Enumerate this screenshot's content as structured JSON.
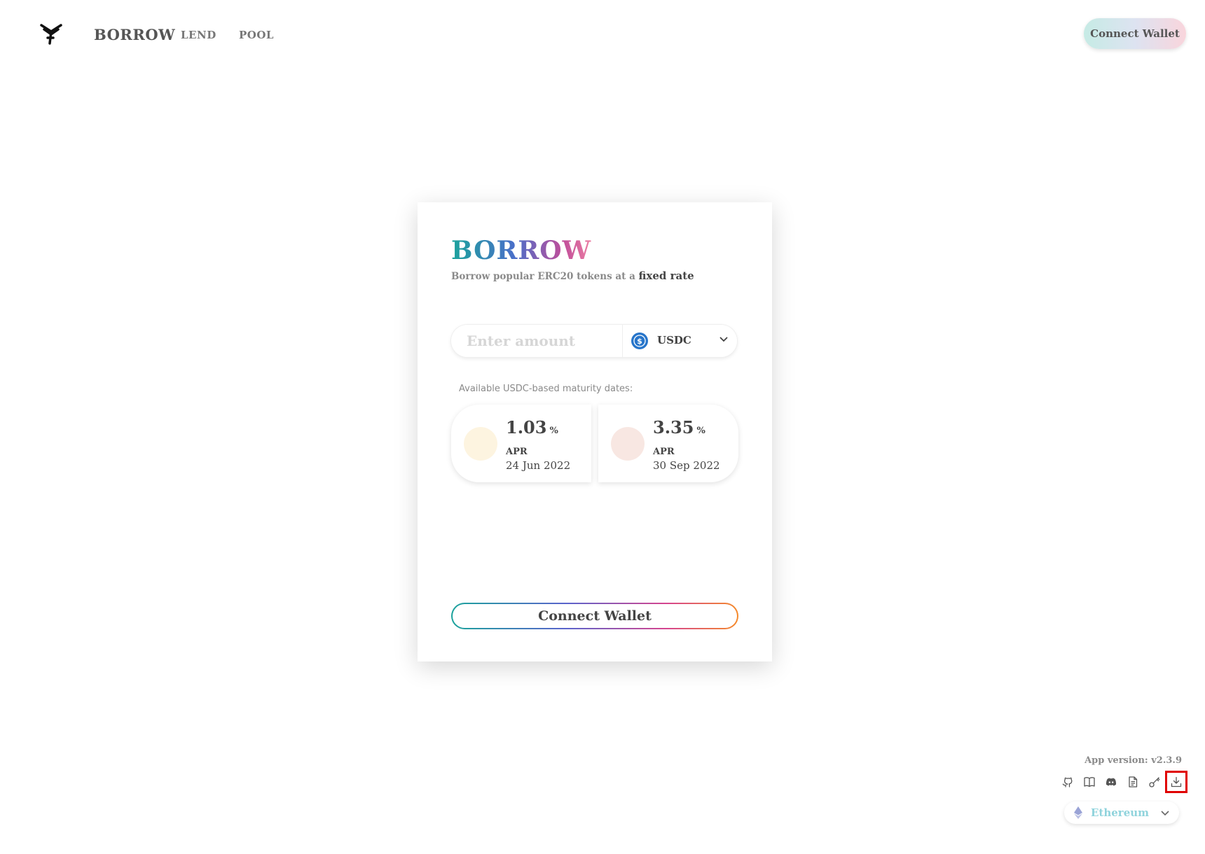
{
  "header": {
    "nav": {
      "borrow": "BORROW",
      "lend": "LEND",
      "pool": "POOL"
    },
    "connect_label": "Connect Wallet"
  },
  "card": {
    "title": "BORROW",
    "subtitle_prefix": "Borrow popular ERC20 tokens at a ",
    "subtitle_emphasis": "fixed rate",
    "amount": {
      "value": "",
      "placeholder": "Enter amount"
    },
    "token": {
      "selected": "USDC",
      "icon": "usdc-icon"
    },
    "maturities_label": "Available USDC-based maturity dates:",
    "pools": [
      {
        "rate": "1.03",
        "unit": "%",
        "label": "APR",
        "date": "24 Jun 2022",
        "color": "#fdf4e0"
      },
      {
        "rate": "3.35",
        "unit": "%",
        "label": "APR",
        "date": "30 Sep 2022",
        "color": "#f8e7e2"
      }
    ],
    "connect_label": "Connect Wallet"
  },
  "footer": {
    "app_version": "App version: v2.3.9",
    "icons": [
      "github-icon",
      "docs-book-icon",
      "discord-icon",
      "document-icon",
      "key-icon",
      "download-icon"
    ],
    "selected_icon": "download-icon",
    "network": {
      "label": "Ethereum",
      "icon": "ethereum-icon"
    }
  },
  "colors": {
    "accent_gradient": [
      "#1ba39c",
      "#5a64cc",
      "#d6458f",
      "#f58a2a"
    ],
    "header_button_gradient": [
      "#c6ebe5",
      "#dde3f1",
      "#f9d5dc"
    ],
    "selection_outline": "#e00000"
  }
}
